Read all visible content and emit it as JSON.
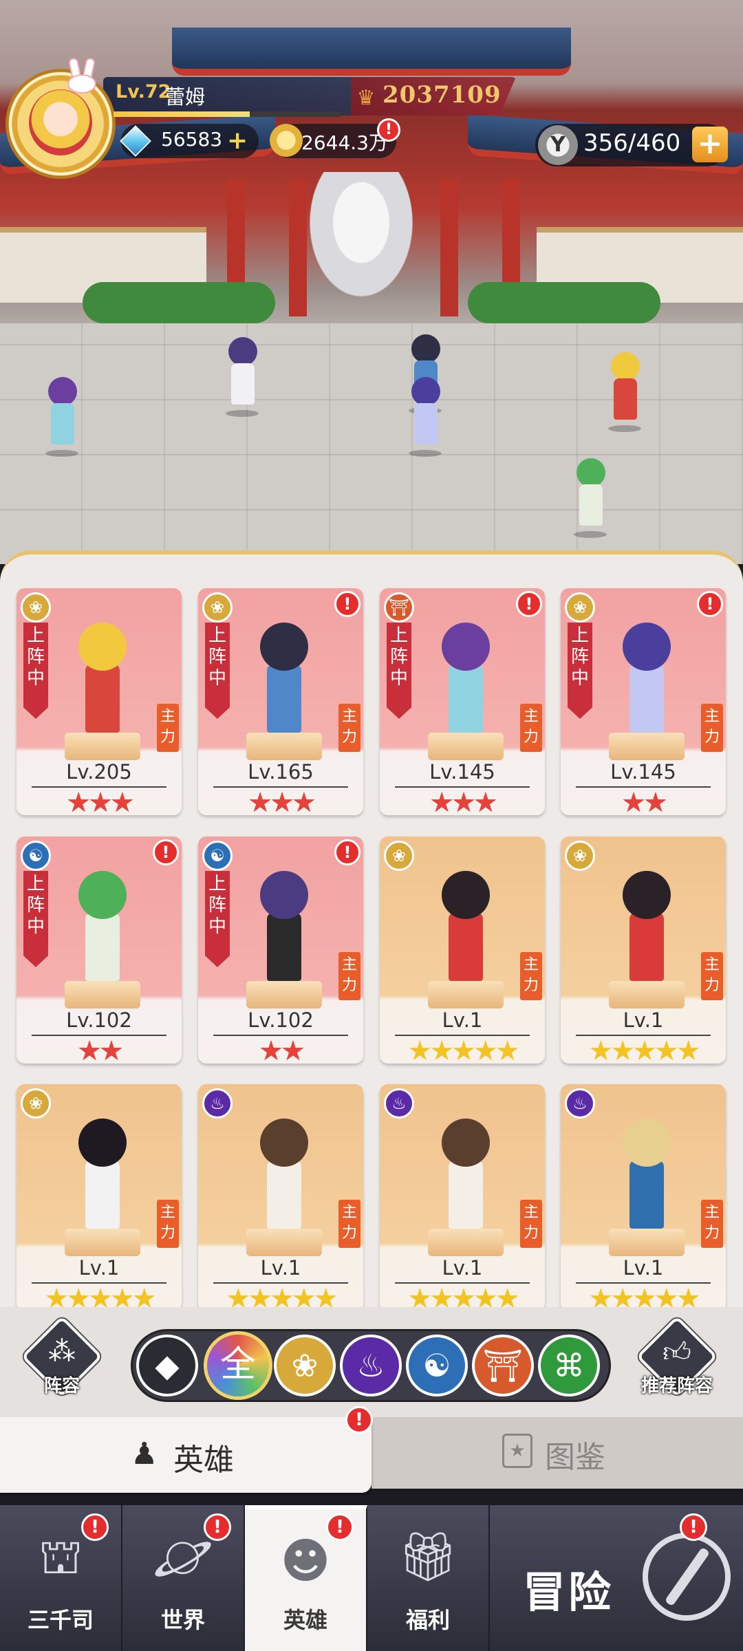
{
  "player": {
    "level": "Lv.72",
    "name": "蕾姆",
    "power": "2037109",
    "exp_fraction": 0.6,
    "gems": "56583",
    "gold": "2644.3万",
    "stamina": "356/460"
  },
  "heroes": [
    {
      "level": "Lv.205",
      "stars": "★★★",
      "star_color": "red",
      "deployed_label": "上阵中",
      "role": "主力",
      "element_icon": "lotus-icon",
      "has_alert": false,
      "card_color": "red"
    },
    {
      "level": "Lv.165",
      "stars": "★★★",
      "star_color": "red",
      "deployed_label": "上阵中",
      "role": "主力",
      "element_icon": "lotus-icon",
      "has_alert": true,
      "card_color": "red"
    },
    {
      "level": "Lv.145",
      "stars": "★★★",
      "star_color": "red",
      "deployed_label": "上阵中",
      "role": "主力",
      "element_icon": "meditation-icon",
      "has_alert": true,
      "card_color": "red"
    },
    {
      "level": "Lv.145",
      "stars": "★★",
      "star_color": "red",
      "deployed_label": "上阵中",
      "role": "主力",
      "element_icon": "lotus-icon",
      "has_alert": true,
      "card_color": "red"
    },
    {
      "level": "Lv.102",
      "stars": "★★",
      "star_color": "red",
      "deployed_label": "上阵中",
      "role": "",
      "element_icon": "swirl-icon",
      "has_alert": true,
      "card_color": "red"
    },
    {
      "level": "Lv.102",
      "stars": "★★",
      "star_color": "red",
      "deployed_label": "上阵中",
      "role": "主力",
      "element_icon": "swirl-icon",
      "has_alert": true,
      "card_color": "red"
    },
    {
      "level": "Lv.1",
      "stars": "★★★★★",
      "star_color": "yellow",
      "deployed_label": "",
      "role": "主力",
      "element_icon": "lotus-icon",
      "has_alert": false,
      "card_color": "gold"
    },
    {
      "level": "Lv.1",
      "stars": "★★★★★",
      "star_color": "yellow",
      "deployed_label": "",
      "role": "主力",
      "element_icon": "lotus-icon",
      "has_alert": false,
      "card_color": "gold"
    },
    {
      "level": "Lv.1",
      "stars": "★★★★★",
      "star_color": "yellow",
      "deployed_label": "",
      "role": "主力",
      "element_icon": "lotus-icon",
      "has_alert": false,
      "card_color": "gold"
    },
    {
      "level": "Lv.1",
      "stars": "★★★★★",
      "star_color": "yellow",
      "deployed_label": "",
      "role": "主力",
      "element_icon": "flame-icon",
      "has_alert": false,
      "card_color": "gold"
    },
    {
      "level": "Lv.1",
      "stars": "★★★★★",
      "star_color": "yellow",
      "deployed_label": "",
      "role": "主力",
      "element_icon": "flame-icon",
      "has_alert": false,
      "card_color": "gold"
    },
    {
      "level": "Lv.1",
      "stars": "★★★★★",
      "star_color": "yellow",
      "deployed_label": "",
      "role": "主力",
      "element_icon": "flame-icon",
      "has_alert": false,
      "card_color": "gold"
    }
  ],
  "filter": {
    "formation_label": "阵容",
    "recommend_label": "推荐阵容",
    "all_label": "全",
    "icons": [
      "diamond-icon",
      "all-icon",
      "lotus-icon",
      "flame-icon",
      "swirl-icon",
      "meditation-icon",
      "dna-icon"
    ],
    "selected": "all-icon"
  },
  "tabs": {
    "hero": "英雄",
    "book": "图鉴"
  },
  "nav": {
    "items": [
      "三千司",
      "世界",
      "英雄",
      "福利"
    ],
    "adventure": "冒险",
    "active": "英雄"
  },
  "alert_glyph": "!",
  "colors": {
    "accent_gold": "#f2c34e",
    "alert_red": "#e52d2d",
    "deployed_red": "#c82f3a"
  }
}
